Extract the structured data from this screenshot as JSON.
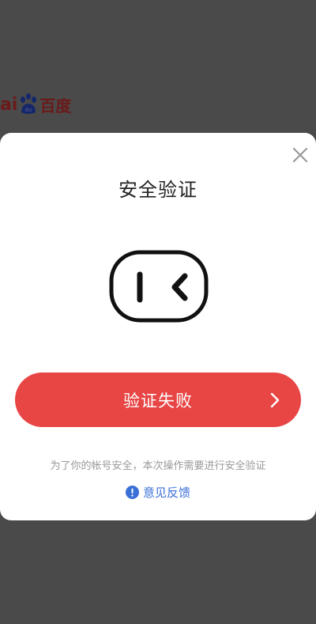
{
  "background": {
    "logo_prefix": "ai",
    "logo_paw_text": "du",
    "logo_cn": "百度",
    "footer_text": "...."
  },
  "modal": {
    "title": "安全验证",
    "button_label": "验证失败",
    "notice": "为了你的帐号安全，本次操作需要进行安全验证",
    "feedback_label": "意见反馈"
  },
  "colors": {
    "accent": "#e84545",
    "link": "#3a6fd8",
    "overlay": "#4a4a4a"
  },
  "icons": [
    "close-icon",
    "face-icon",
    "chevron-right-icon",
    "info-icon",
    "paw-icon"
  ]
}
